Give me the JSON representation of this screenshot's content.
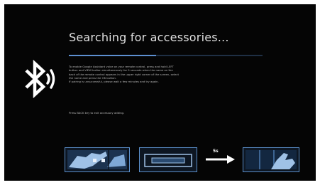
{
  "screen": {
    "title": "Searching for accessories...",
    "progress": 0.45,
    "instructions": [
      "To enable Google Assistant voice on your remote control, press and hold LEFT",
      "button and VIEW button simultaneously for 5 seconds when the name on the",
      "back of the remote control appears in the upper right corner of the screen, select",
      "the name and press the OK button.",
      "If pairing is unsuccessful, please wait a few minutes and try again."
    ],
    "back_hint": "Press BACK key to exit accessory adding."
  },
  "illustration": {
    "hold_duration_label": "5s"
  },
  "colors": {
    "screen_background": "#050505",
    "title_text": "#e0e0e0",
    "progress_track": "#1f2f44",
    "progress_fill": "#5d8fd0",
    "illustration_fill": "#5a8ec9"
  },
  "icons": {
    "pairing": "bluetooth-icon",
    "step_1": "remote-hold-icon",
    "step_2": "tv-box-icon",
    "step_3": "arrow-right-icon",
    "step_4": "remote-hand-icon"
  }
}
